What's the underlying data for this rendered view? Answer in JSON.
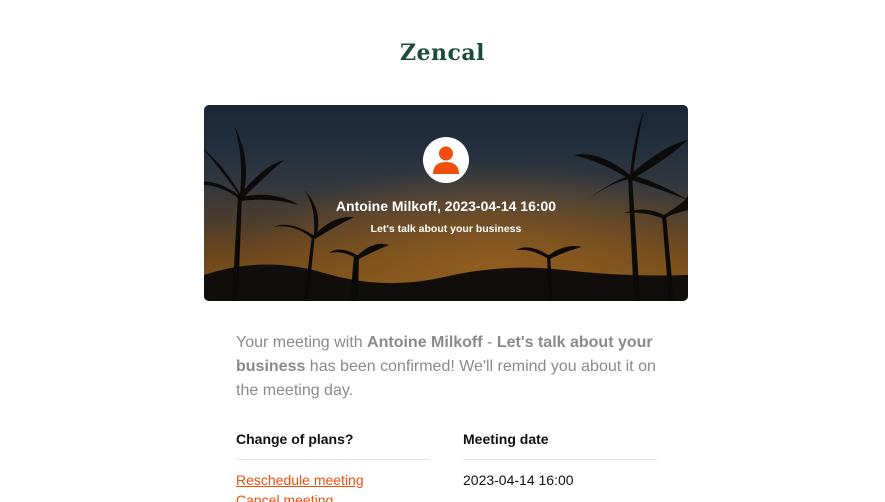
{
  "brand": {
    "name": "Zencal"
  },
  "hero": {
    "title": "Antoine Milkoff, 2023-04-14 16:00",
    "subtitle": "Let's talk about your business",
    "avatar_icon": "user-icon",
    "accent_color": "#f04e0c"
  },
  "message": {
    "prefix": "Your meeting with ",
    "host": "Antoine Milkoff",
    "separator": " - ",
    "meeting_name": "Let's talk about your business",
    "suffix": " has been confirmed! We'll remind you about it on the meeting day."
  },
  "plans": {
    "heading": "Change of plans?",
    "reschedule_label": "Reschedule meeting",
    "cancel_label": "Cancel meeting"
  },
  "meeting_date": {
    "heading": "Meeting date",
    "value": "2023-04-14 16:00"
  },
  "colors": {
    "brand": "#1c4b3a",
    "link": "#f04e0c",
    "muted_text": "#8a8a8a"
  }
}
